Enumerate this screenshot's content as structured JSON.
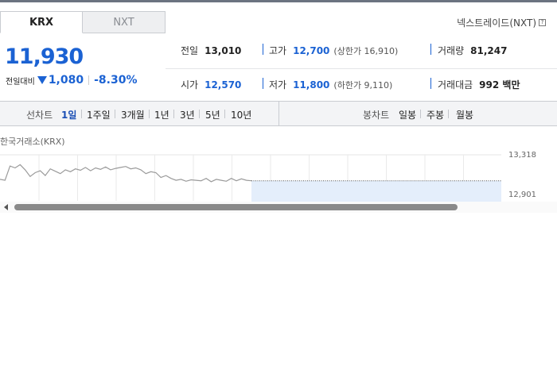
{
  "tabs": [
    {
      "label": "KRX",
      "active": true
    },
    {
      "label": "NXT",
      "active": false
    }
  ],
  "nxt_link": "넥스트레이드(NXT)",
  "help_icon_glyph": "?",
  "price": "11,930",
  "change": {
    "label": "전일대비",
    "amount": "1,080",
    "percent": "-8.30%",
    "direction": "down"
  },
  "stats": {
    "prev_close": {
      "label": "전일",
      "value": "13,010"
    },
    "high": {
      "label": "고가",
      "value": "12,700",
      "sub": "(상한가 16,910)"
    },
    "volume": {
      "label": "거래량",
      "value": "81,247"
    },
    "open": {
      "label": "시가",
      "value": "12,570"
    },
    "low": {
      "label": "저가",
      "value": "11,800",
      "sub": "(하한가 9,110)"
    },
    "amount": {
      "label": "거래대금",
      "value": "992 백만"
    }
  },
  "toolbar": {
    "line_label": "선차트",
    "periods": [
      "1일",
      "1주일",
      "3개월",
      "1년",
      "3년",
      "5년",
      "10년"
    ],
    "active_period": "1일",
    "candle_label": "봉차트",
    "candle_types": [
      "일봉",
      "주봉",
      "월봉"
    ]
  },
  "market_label": "한국거래소(KRX)",
  "colors": {
    "accent": "#1b62d3",
    "line": "#9a9a9a",
    "fill": "#e4eefb"
  },
  "chart_data": {
    "type": "line",
    "y_ticks": [
      "13,318",
      "12,901"
    ],
    "ylim": [
      12901,
      13318
    ],
    "values": [
      13060,
      13050,
      13200,
      13180,
      13215,
      13160,
      13090,
      13130,
      13150,
      13100,
      13170,
      13145,
      13120,
      13160,
      13140,
      13170,
      13155,
      13185,
      13150,
      13180,
      13165,
      13190,
      13160,
      13175,
      13185,
      13195,
      13170,
      13180,
      13160,
      13120,
      13140,
      13130,
      13080,
      13100,
      13070,
      13050,
      13060,
      13040,
      13055,
      13050,
      13045,
      13070,
      13035,
      13060,
      13050,
      13040,
      13070,
      13045,
      13065,
      13050,
      13045
    ],
    "prev_close": 13010,
    "grid": true
  }
}
